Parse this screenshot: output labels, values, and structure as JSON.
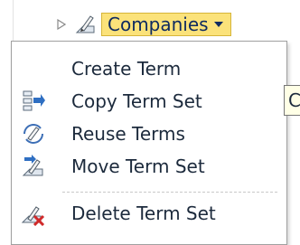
{
  "term_node": {
    "label": "Companies",
    "icon": "tag-pencil-icon",
    "expander_icon": "triangle-right-icon"
  },
  "menu": {
    "items": [
      {
        "label": "Create Term",
        "icon": ""
      },
      {
        "label": "Copy Term Set",
        "icon": "copy-term-set-icon"
      },
      {
        "label": "Reuse Terms",
        "icon": "reuse-terms-icon"
      },
      {
        "label": "Move Term Set",
        "icon": "move-term-set-icon"
      },
      {
        "label": "Delete Term Set",
        "icon": "delete-term-set-icon"
      }
    ]
  },
  "tooltip": {
    "text": "C"
  },
  "colors": {
    "highlight": "#fbe27a",
    "highlight_border": "#d6b53a",
    "menu_border": "#a0a0a0",
    "text": "#1c2a3c"
  }
}
